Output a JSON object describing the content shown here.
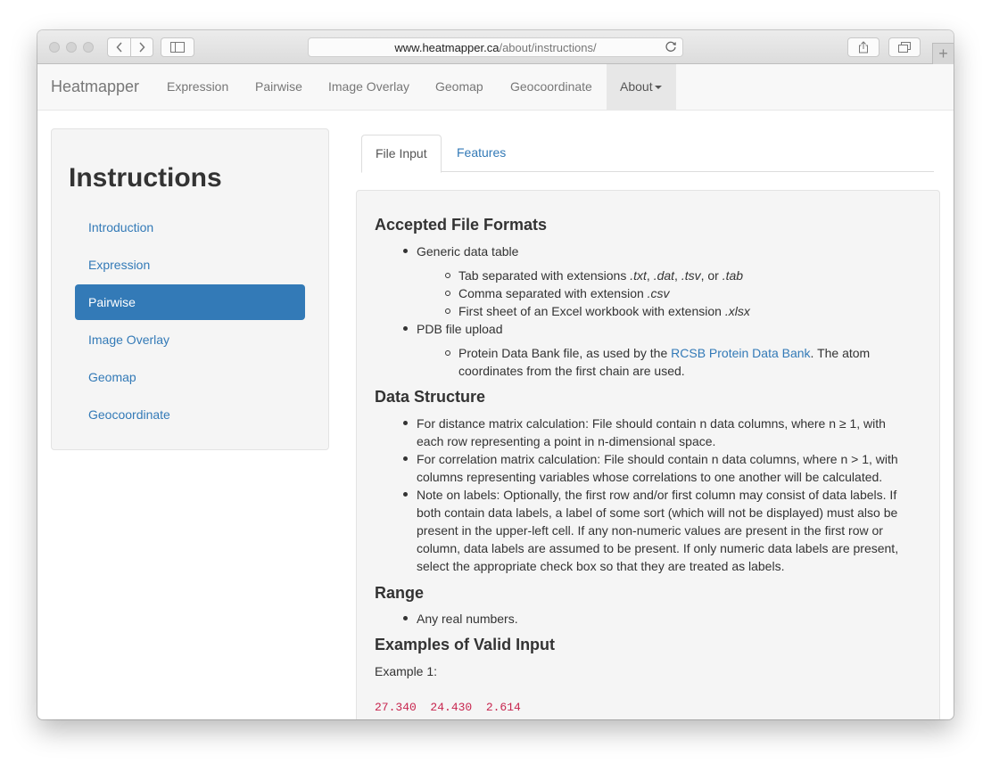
{
  "browser": {
    "url_domain": "www.heatmapper.ca",
    "url_path": "/about/instructions/"
  },
  "navbar": {
    "brand": "Heatmapper",
    "items": [
      "Expression",
      "Pairwise",
      "Image Overlay",
      "Geomap",
      "Geocoordinate",
      "About"
    ]
  },
  "sidebar": {
    "title": "Instructions",
    "items": [
      "Introduction",
      "Expression",
      "Pairwise",
      "Image Overlay",
      "Geomap",
      "Geocoordinate"
    ]
  },
  "tabs": [
    "File Input",
    "Features"
  ],
  "content": {
    "h_formats": "Accepted File Formats",
    "generic": "Generic data table",
    "tab_sep_prefix": "Tab separated with extensions ",
    "ext_txt": ".txt",
    "ext_dat": ".dat",
    "ext_tsv": ".tsv",
    "ext_tab": ".tab",
    "comma_prefix": "Comma separated with extension ",
    "ext_csv": ".csv",
    "excel_prefix": "First sheet of an Excel workbook with extension ",
    "ext_xlsx": ".xlsx",
    "pdb": "PDB file upload",
    "pdb_prefix": "Protein Data Bank file, as used by the ",
    "pdb_link": "RCSB Protein Data Bank",
    "pdb_suffix_1": ". The atom",
    "pdb_suffix_2": "coordinates from the first chain are used.",
    "h_structure": "Data Structure",
    "dist_1": "For distance matrix calculation: File should contain n data columns, where n ≥ 1, with",
    "dist_2": "each row representing a point in n-dimensional space.",
    "corr_1": "For correlation matrix calculation: File should contain n data columns, where n > 1, with",
    "corr_2": "columns representing variables whose correlations to one another will be calculated.",
    "labels_1": "Note on labels: Optionally, the first row and/or first column may consist of data labels. If",
    "labels_2": "both contain data labels, a label of some sort (which will not be displayed) must also be",
    "labels_3": "present in the upper-left cell. If any non-numeric values are present in the first row or",
    "labels_4": "column, data labels are assumed to be present. If only numeric data labels are present,",
    "labels_5": "select the appropriate check box so that they are treated as labels.",
    "h_range": "Range",
    "range": "Any real numbers.",
    "h_examples": "Examples of Valid Input",
    "example1": "Example 1:",
    "code_line": "27.340  24.430  2.614"
  }
}
